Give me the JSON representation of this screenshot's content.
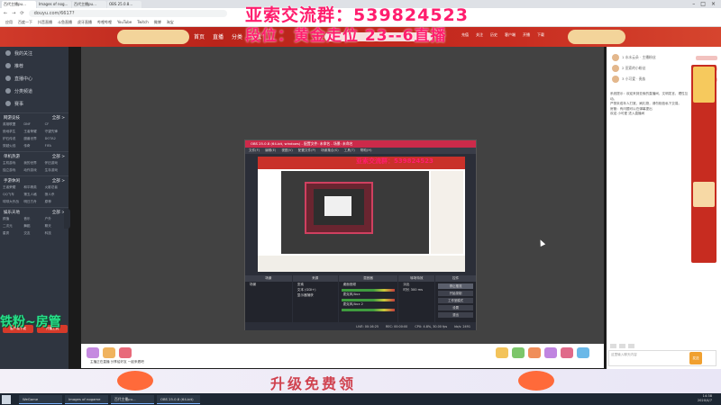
{
  "browser": {
    "tabs": [
      "百代主播pu...",
      "Images of nog...",
      "百代主播pu...",
      "OBS 25.0.8..."
    ],
    "url": "douyu.com/6617?",
    "window_controls": [
      "–",
      "□",
      "×"
    ],
    "bookmarks": [
      "应用",
      "百度一下",
      "抖音直播",
      "斗鱼直播",
      "虎牙直播",
      "哔哩哔哩",
      "YouTube",
      "Twitch",
      "微博",
      "淘宝"
    ]
  },
  "overlay": {
    "line1": "亚索交流群：539824523",
    "line2": "段位：黄金走位 23--6直播"
  },
  "site_header": {
    "nav": [
      "首页",
      "直播",
      "分类",
      "游戏"
    ],
    "right_items": [
      "充值",
      "关注",
      "历史",
      "客户端",
      "开播",
      "下载"
    ]
  },
  "sidebar": {
    "main_nav": [
      "我的关注",
      "推荐",
      "直播中心",
      "分类频道",
      "赛事"
    ],
    "sections": [
      {
        "title": "网游竞技",
        "more": "全部 >",
        "items": [
          "英雄联盟",
          "DNF",
          "CF",
          "绝地求生",
          "王者荣耀",
          "守望先锋",
          "炉石传说",
          "魔兽世界",
          "DOTA2",
          "穿越火线",
          "传奇",
          "FIFA"
        ]
      },
      {
        "title": "单机热游",
        "more": "全部 >",
        "items": [
          "主机游戏",
          "我的世界",
          "怀旧游戏",
          "独立游戏",
          "动作游戏",
          "生存游戏"
        ]
      },
      {
        "title": "手游休闲",
        "more": "全部 >",
        "items": [
          "王者荣耀",
          "和平精英",
          "火影忍者",
          "QQ飞车",
          "第五人格",
          "狼人杀",
          "球球大作战",
          "明日方舟",
          "原神"
        ]
      },
      {
        "title": "娱乐天地",
        "more": "全部 >",
        "items": [
          "颜值",
          "音乐",
          "户外",
          "二次元",
          "舞蹈",
          "聊天",
          "星秀",
          "交友",
          "科技"
        ]
      }
    ],
    "buttons": [
      "客户端下载",
      "开播工具"
    ]
  },
  "obs": {
    "title": "OBS 25.0.8 (64-bit, windows) - 配置文件: 未命名 - 场景: 未命名",
    "menu": [
      "文件(F)",
      "编辑(E)",
      "视图(V)",
      "配置文件(P)",
      "场景集合(S)",
      "工具(T)",
      "帮助(H)"
    ],
    "preview_text": "亚索交流群：539824523",
    "docks": {
      "scenes": {
        "title": "场景",
        "items": [
          "场景"
        ]
      },
      "sources": {
        "title": "来源",
        "items": [
          "亚索",
          "文本 (GDI+)",
          "显示器捕获"
        ]
      },
      "mixer": {
        "title": "混音器",
        "channels": [
          "桌面音频",
          "麦克风/Aux",
          "麦克风/Aux 2"
        ]
      },
      "transitions": {
        "title": "转场特效",
        "items": [
          "淡出",
          "时长 300 ms"
        ]
      },
      "controls": {
        "title": "控件",
        "buttons": [
          "停止推流",
          "开始录制",
          "工作室模式",
          "设置",
          "退出"
        ]
      }
    },
    "status": [
      "LIVE: 00:16:25",
      "REC: 00:00:00",
      "CPU: 4.8%, 30.00 fps",
      "kb/s: 2491"
    ]
  },
  "gift_bar": {
    "message": "主播正在直播 分享给好友 一起来看吧"
  },
  "right_panel": {
    "ranks": [
      "1 水水云朵 · 主播粉丝",
      "2 亚索的小粉丝",
      "3 小可爱 · 贵族"
    ],
    "chat": [
      "系统提示：欢迎来到亚索的直播间，文明发言，理性互动。",
      "严禁未成年人打赏、刷礼物，请勿相信私下交易。",
      "房管：有问题可以在弹幕提出",
      "欢迎 小可爱 进入直播间"
    ],
    "input_placeholder": "这里输入聊天内容",
    "send_label": "发送"
  },
  "bottom_banner": {
    "text": "升级免费领"
  },
  "lw_text": "铁粉~房管",
  "taskbar": {
    "items": [
      "WeGame",
      "Images of nogame",
      "百代主播pu...",
      "OBS 25.0.8 (64-bit)"
    ],
    "time": "14:38",
    "date": "2020/4/7"
  }
}
